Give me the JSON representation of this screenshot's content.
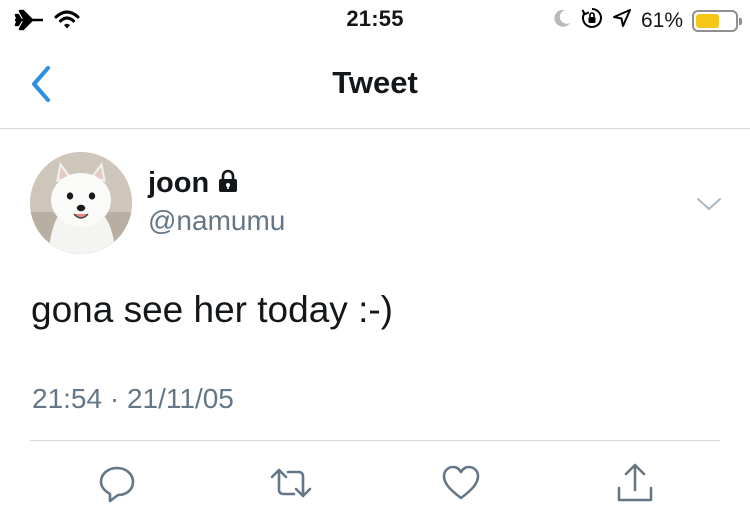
{
  "status_bar": {
    "time": "21:55",
    "battery_percent_label": "61%",
    "battery_level": 0.61,
    "battery_color": "#f5c518",
    "icons": [
      "airplane-mode-icon",
      "wifi-icon",
      "moon-icon",
      "rotation-lock-icon",
      "location-arrow-icon",
      "battery-icon"
    ]
  },
  "nav": {
    "back_icon": "chevron-left-icon",
    "title": "Tweet",
    "accent_color": "#2f8ee0"
  },
  "tweet": {
    "author": {
      "display_name": "joon",
      "handle": "@namumu",
      "protected": true,
      "protected_icon": "lock-icon",
      "avatar": "white-dog-avatar"
    },
    "text": "gona see her today :-)",
    "timestamp": "21:54 · 21/11/05",
    "menu_icon": "chevron-down-icon"
  },
  "actions": [
    {
      "name": "reply",
      "icon": "reply-icon"
    },
    {
      "name": "retweet",
      "icon": "retweet-icon"
    },
    {
      "name": "like",
      "icon": "heart-icon"
    },
    {
      "name": "share",
      "icon": "share-icon"
    }
  ],
  "colors": {
    "text_primary": "#14171a",
    "text_secondary": "#657786",
    "divider": "#d5d9dd"
  }
}
